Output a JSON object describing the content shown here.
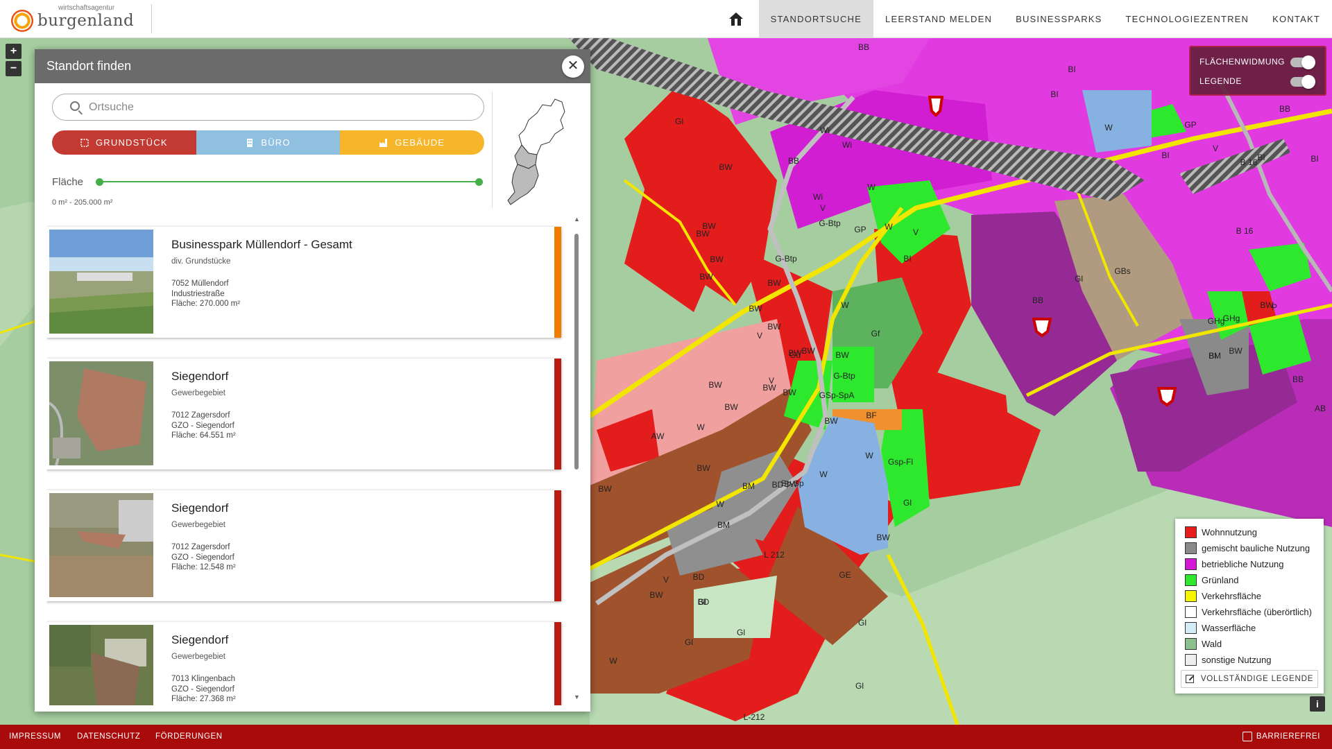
{
  "header": {
    "logo_small": "wirtschaftsagentur",
    "logo_big": "burgenland",
    "nav": [
      {
        "label": "STANDORTSUCHE",
        "active": true
      },
      {
        "label": "LEERSTAND MELDEN"
      },
      {
        "label": "BUSINESSPARKS"
      },
      {
        "label": "TECHNOLOGIEZENTREN"
      },
      {
        "label": "KONTAKT"
      }
    ],
    "home_icon": "home-icon"
  },
  "map_controls": {
    "zoom_in": "+",
    "zoom_out": "−",
    "info": "i"
  },
  "panel": {
    "title": "Standort finden",
    "close": "✕",
    "search_placeholder": "Ortsuche",
    "tabs": [
      {
        "label": "GRUNDSTÜCK",
        "icon": "selection-icon",
        "color": "#c23a32"
      },
      {
        "label": "BÜRO",
        "icon": "building-icon",
        "color": "#90c0e0"
      },
      {
        "label": "GEBÄUDE",
        "icon": "factory-icon",
        "color": "#f7b52a"
      }
    ],
    "flaeche_label": "Fläche",
    "range_text": "0 m² - 205.000 m²",
    "results": [
      {
        "title": "Businesspark Müllendorf - Gesamt",
        "subtitle": "div. Grundstücke",
        "line1": "7052 Müllendorf",
        "line2": "Industriestraße",
        "line3": "Fläche: 270.000 m²",
        "bar_color": "#ee7d00"
      },
      {
        "title": "Siegendorf",
        "subtitle": "Gewerbegebiet",
        "line1": "7012 Zagersdorf",
        "line2": "GZO - Siegendorf",
        "line3": "Fläche: 64.551 m²",
        "bar_color": "#b81d14"
      },
      {
        "title": "Siegendorf",
        "subtitle": "Gewerbegebiet",
        "line1": "7012 Zagersdorf",
        "line2": "GZO - Siegendorf",
        "line3": "Fläche: 12.548 m²",
        "bar_color": "#b81d14"
      },
      {
        "title": "Siegendorf",
        "subtitle": "Gewerbegebiet",
        "line1": "7013 Klingenbach",
        "line2": "GZO - Siegendorf",
        "line3": "Fläche: 27.368 m²",
        "bar_color": "#b81d14"
      }
    ]
  },
  "toggles": [
    {
      "label": "FLÄCHENWIDMUNG",
      "on": true
    },
    {
      "label": "LEGENDE",
      "on": true
    }
  ],
  "legend": {
    "items": [
      {
        "label": "Wohnnutzung",
        "color": "#e81c1c"
      },
      {
        "label": "gemischt bauliche Nutzung",
        "color": "#8a8a8a"
      },
      {
        "label": "betriebliche Nutzung",
        "color": "#d418d4"
      },
      {
        "label": "Grünland",
        "color": "#2ee82e"
      },
      {
        "label": "Verkehrsfläche",
        "color": "#f5f500"
      },
      {
        "label": "Verkehrsfläche (überörtlich)",
        "color": "#ffffff"
      },
      {
        "label": "Wasserfläche",
        "color": "#d4ecf8"
      },
      {
        "label": "Wald",
        "color": "#8cc08c"
      },
      {
        "label": "sonstige Nutzung",
        "color": "#eeeeee"
      }
    ],
    "full_legend": "VOLLSTÄNDIGE LEGENDE"
  },
  "map_labels": [
    "BB",
    "BI",
    "BI",
    "W",
    "GP",
    "V",
    "BI",
    "BB",
    "B 16",
    "BI",
    "BI",
    "B 16",
    "P",
    "BW",
    "GHg",
    "BW",
    "BI",
    "GHg",
    "BM",
    "BB",
    "GBs",
    "Gl",
    "BB",
    "AB",
    "BW",
    "BW",
    "BW",
    "BW",
    "Gf",
    "BW",
    "BW",
    "Gü",
    "BW",
    "BW",
    "G-Btp",
    "GSp-SpA",
    "BF",
    "W",
    "Gsp-Fl",
    "Gl",
    "BW",
    "GE",
    "Gl",
    "Gl",
    "BD",
    "BM",
    "W",
    "BM",
    "BD",
    "BD",
    "W",
    "Gl",
    "BW",
    "AW",
    "BW",
    "BW",
    "BW",
    "Wi",
    "Wi",
    "Gl",
    "BW",
    "BW",
    "V",
    "Wi",
    "BB",
    "G-Btp",
    "W",
    "G-Btp",
    "GP",
    "V",
    "W",
    "V",
    "BI",
    "W",
    "BW",
    "BW",
    "BW",
    "V",
    "Gl",
    "Gl",
    "L-212",
    "L 212",
    "Sp-Sp",
    "W",
    "V",
    "W",
    "BW",
    "BW",
    "BW"
  ],
  "footer": {
    "links": [
      "IMPRESSUM",
      "DATENSCHUTZ",
      "FÖRDERUNGEN"
    ],
    "barrier": "BARRIEREFREI"
  }
}
